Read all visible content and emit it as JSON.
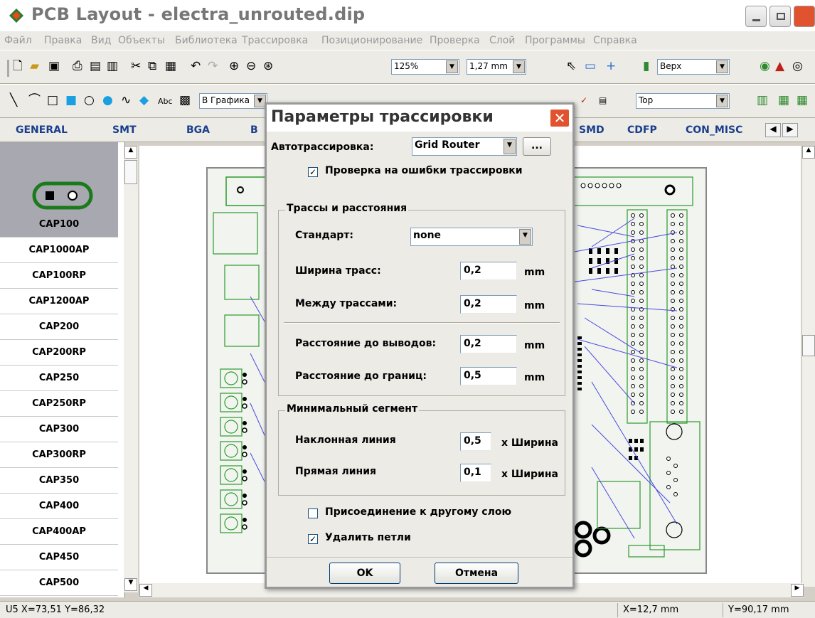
{
  "window": {
    "title": "PCB Layout - electra_unrouted.dip"
  },
  "menu": [
    "Файл",
    "Правка",
    "Вид",
    "Объекты",
    "Библиотека",
    "Трассировка",
    "Позиционирование",
    "Проверка",
    "Слой",
    "Программы",
    "Справка"
  ],
  "toolbar1": {
    "zoom": "125%",
    "grid": "1,27 mm",
    "layer": "Верх"
  },
  "toolbar2": {
    "category": "В Графика",
    "layer": "Top"
  },
  "lib_tabs": [
    "GENERAL",
    "SMT",
    "BGA",
    "B",
    "SMD",
    "CDFP",
    "CON_MISC"
  ],
  "library": {
    "items": [
      "CAP100",
      "CAP1000AP",
      "CAP100RP",
      "CAP1200AP",
      "CAP200",
      "CAP200RP",
      "CAP250",
      "CAP250RP",
      "CAP300",
      "CAP300RP",
      "CAP350",
      "CAP400",
      "CAP400AP",
      "CAP450",
      "CAP500"
    ],
    "selected": "CAP100"
  },
  "status": {
    "left": "U5 X=73,51  Y=86,32",
    "x": "X=12,7 mm",
    "y": "Y=90,17 mm"
  },
  "dialog": {
    "title": "Параметры трассировки",
    "autorouter_label": "Автотрассировка:",
    "autorouter_value": "Grid Router",
    "more_button": "...",
    "check_errors": "Проверка на ошибки трассировки",
    "check_errors_on": true,
    "group1_title": "Трассы и расстояния",
    "standard_label": "Стандарт:",
    "standard_value": "none",
    "width_label": "Ширина трасс:",
    "width_value": "0,2",
    "between_label": "Между трассами:",
    "between_value": "0,2",
    "to_pads_label": "Расстояние до выводов:",
    "to_pads_value": "0,2",
    "to_border_label": "Расстояние до границ:",
    "to_border_value": "0,5",
    "unit": "mm",
    "group2_title": "Минимальный сегмент",
    "diag_label": "Наклонная линия",
    "diag_value": "0,5",
    "straight_label": "Прямая линия",
    "straight_value": "0,1",
    "times_width": "x Ширина",
    "connect_other_layer": "Присоединение к другому слою",
    "connect_other_layer_on": false,
    "remove_loops": "Удалить петли",
    "remove_loops_on": true,
    "ok": "OK",
    "cancel": "Отмена"
  },
  "colors": {
    "trace": "#4a4ae0",
    "outline": "#2c9a2c",
    "pad": "#000000"
  }
}
